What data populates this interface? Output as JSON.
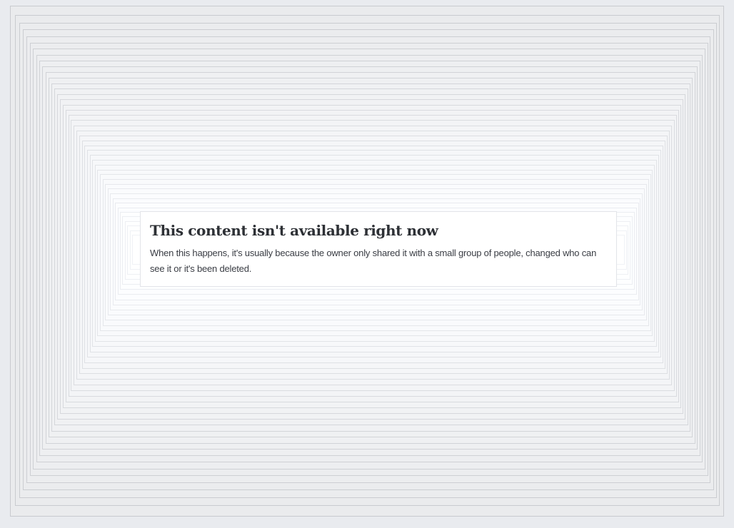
{
  "colors": {
    "background": "#e9ebef",
    "panel": "#ffffff",
    "panel_border": "#e2e4e9",
    "title_text": "#2d3035",
    "body_text": "#3a3d44",
    "frame_shadow": "#d2d5dd"
  },
  "notice": {
    "title": "This content isn't available right now",
    "body": "When this happens, it's usually because the owner only shared it with a small group of people, changed who can see it or it's been deleted."
  }
}
